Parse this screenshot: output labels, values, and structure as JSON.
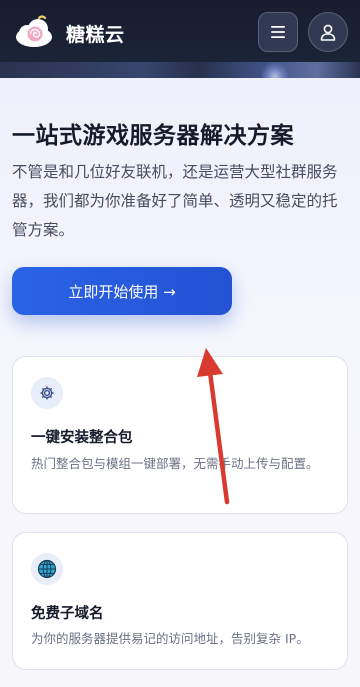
{
  "header": {
    "brand_name": "糖糕云",
    "logo": "cloud-with-swirl-candy-logo",
    "menu_icon": "hamburger-menu-icon",
    "user_icon": "user-icon"
  },
  "hero": {
    "title": "一站式游戏服务器解决方案",
    "description": "不管是和几位好友联机，还是运营大型社群服务器，我们都为你准备好了简单、透明又稳定的托管方案。",
    "cta_label": "立即开始使用 →"
  },
  "features": [
    {
      "icon": "gear-icon",
      "title": "一键安装整合包",
      "description": "热门整合包与模组一键部署，无需手动上传与配置。"
    },
    {
      "icon": "globe-icon",
      "title": "免费子域名",
      "description": "为你的服务器提供易记的访问地址，告别复杂 IP。"
    }
  ],
  "colors": {
    "header_bg": "#1a2236",
    "accent": "#2b63e6",
    "annotation_arrow": "#d83a2f"
  }
}
